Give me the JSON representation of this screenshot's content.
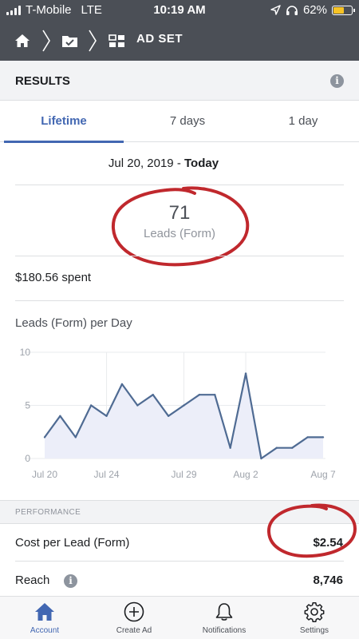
{
  "status_bar": {
    "carrier": "T-Mobile",
    "network": "LTE",
    "time": "10:19 AM",
    "battery": "62%",
    "battery_level": 0.62,
    "battery_color": "#f7c325"
  },
  "nav": {
    "home_icon": "home-icon",
    "campaign_icon": "folder-check-icon",
    "adset_icon": "grid-icon",
    "title": "AD SET"
  },
  "results": {
    "label": "RESULTS",
    "info": "i"
  },
  "tabs": [
    {
      "label": "Lifetime",
      "active": true
    },
    {
      "label": "7 days",
      "active": false
    },
    {
      "label": "1 day",
      "active": false
    }
  ],
  "date_range": {
    "start": "Jul 20, 2019",
    "separator": " - ",
    "end": "Today"
  },
  "metric": {
    "value": "71",
    "label": "Leads (Form)"
  },
  "spent": "$180.56 spent",
  "chart_title": "Leads (Form) per Day",
  "chart_data": {
    "type": "area",
    "title": "Leads (Form) per Day",
    "xlabel": "",
    "ylabel": "",
    "ylim": [
      0,
      10
    ],
    "y_ticks": [
      "10",
      "5",
      "0"
    ],
    "x_tick_labels": [
      "Jul 20",
      "Jul 24",
      "Jul 29",
      "Aug 2",
      "Aug 7"
    ],
    "x": [
      "Jul 20",
      "Jul 21",
      "Jul 22",
      "Jul 23",
      "Jul 24",
      "Jul 25",
      "Jul 26",
      "Jul 27",
      "Jul 28",
      "Jul 29",
      "Jul 30",
      "Jul 31",
      "Aug 1",
      "Aug 2",
      "Aug 3",
      "Aug 4",
      "Aug 5",
      "Aug 6",
      "Aug 7"
    ],
    "series": [
      {
        "values": [
          2,
          4,
          2,
          5,
          4,
          7,
          5,
          6,
          4,
          5,
          6,
          6,
          1,
          8,
          0,
          1,
          1,
          2,
          2
        ]
      }
    ],
    "grid": true,
    "line_color": "#4f6b93",
    "fill_color": "#eceef9"
  },
  "performance": {
    "label": "PERFORMANCE",
    "rows": [
      {
        "label": "Cost per Lead (Form)",
        "value": "$2.54"
      },
      {
        "label": "Reach",
        "value": "8,746",
        "info": "i"
      }
    ]
  },
  "bottom_tabs": [
    {
      "label": "Account",
      "icon": "home-icon",
      "active": true
    },
    {
      "label": "Create Ad",
      "icon": "plus-circle-icon",
      "active": false
    },
    {
      "label": "Notifications",
      "icon": "bell-icon",
      "active": false
    },
    {
      "label": "Settings",
      "icon": "gear-icon",
      "active": false
    }
  ],
  "colors": {
    "accent": "#4267b2",
    "annotation": "#c0282d"
  }
}
